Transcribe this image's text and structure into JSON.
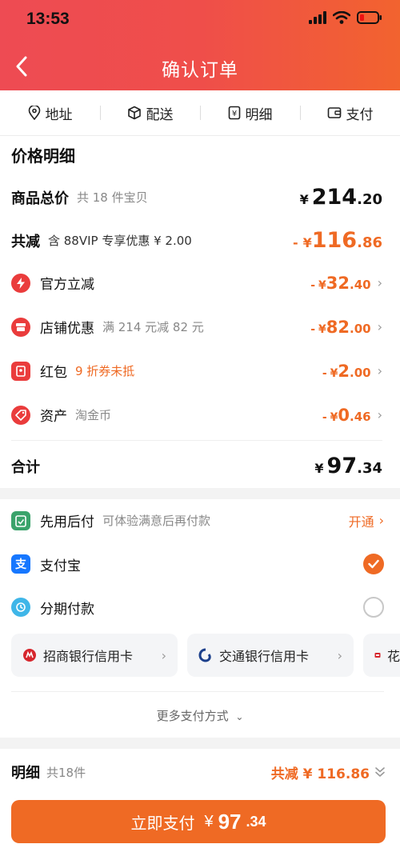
{
  "status_bar": {
    "time": "13:53"
  },
  "header": {
    "title": "确认订单"
  },
  "steps": [
    {
      "label": "地址",
      "icon": "location-pin-icon"
    },
    {
      "label": "配送",
      "icon": "package-box-icon"
    },
    {
      "label": "明细",
      "icon": "receipt-icon"
    },
    {
      "label": "支付",
      "icon": "wallet-icon"
    }
  ],
  "price_detail": {
    "title": "价格明细",
    "goods_total": {
      "label": "商品总价",
      "sub": "共 18 件宝贝",
      "yen": "¥",
      "int": "214",
      "dec": ".20"
    },
    "total_discount": {
      "label": "共减",
      "sub": "含 88VIP 专享优惠 ¥ 2.00",
      "prefix": "-",
      "yen": "¥",
      "int": "116",
      "dec": ".86"
    },
    "items": [
      {
        "label": "官方立减",
        "sub": "",
        "prefix": "-",
        "yen": "¥",
        "int": "32",
        "dec": ".40"
      },
      {
        "label": "店铺优惠",
        "sub": "满 214 元减 82 元",
        "prefix": "-",
        "yen": "¥",
        "int": "82",
        "dec": ".00"
      },
      {
        "label": "红包",
        "sub": "9 折券未抵",
        "prefix": "-",
        "yen": "¥",
        "int": "2",
        "dec": ".00"
      },
      {
        "label": "资产",
        "sub": "淘金币",
        "prefix": "-",
        "yen": "¥",
        "int": "0",
        "dec": ".46"
      }
    ],
    "sum": {
      "label": "合计",
      "yen": "¥",
      "int": "97",
      "dec": ".34"
    }
  },
  "payment": {
    "pay_later": {
      "label": "先用后付",
      "sub": "可体验满意后再付款",
      "action": "开通"
    },
    "alipay": {
      "label": "支付宝",
      "selected": true
    },
    "installment": {
      "label": "分期付款",
      "selected": false
    },
    "banks": [
      {
        "label": "招商银行信用卡"
      },
      {
        "label": "交通银行信用卡"
      },
      {
        "label": "花"
      }
    ],
    "more_label": "更多支付方式"
  },
  "bottom": {
    "label": "明细",
    "count": "共18件",
    "discount_text": "共减 ¥ 116.86",
    "button": {
      "prefix": "立即支付",
      "yen": "¥",
      "int": "97",
      "dec": ".34"
    }
  },
  "colors": {
    "accent": "#ef6a24",
    "header_start": "#ee4b53",
    "header_end": "#f2632f",
    "discount_icon_red": "#ea3c3c"
  }
}
